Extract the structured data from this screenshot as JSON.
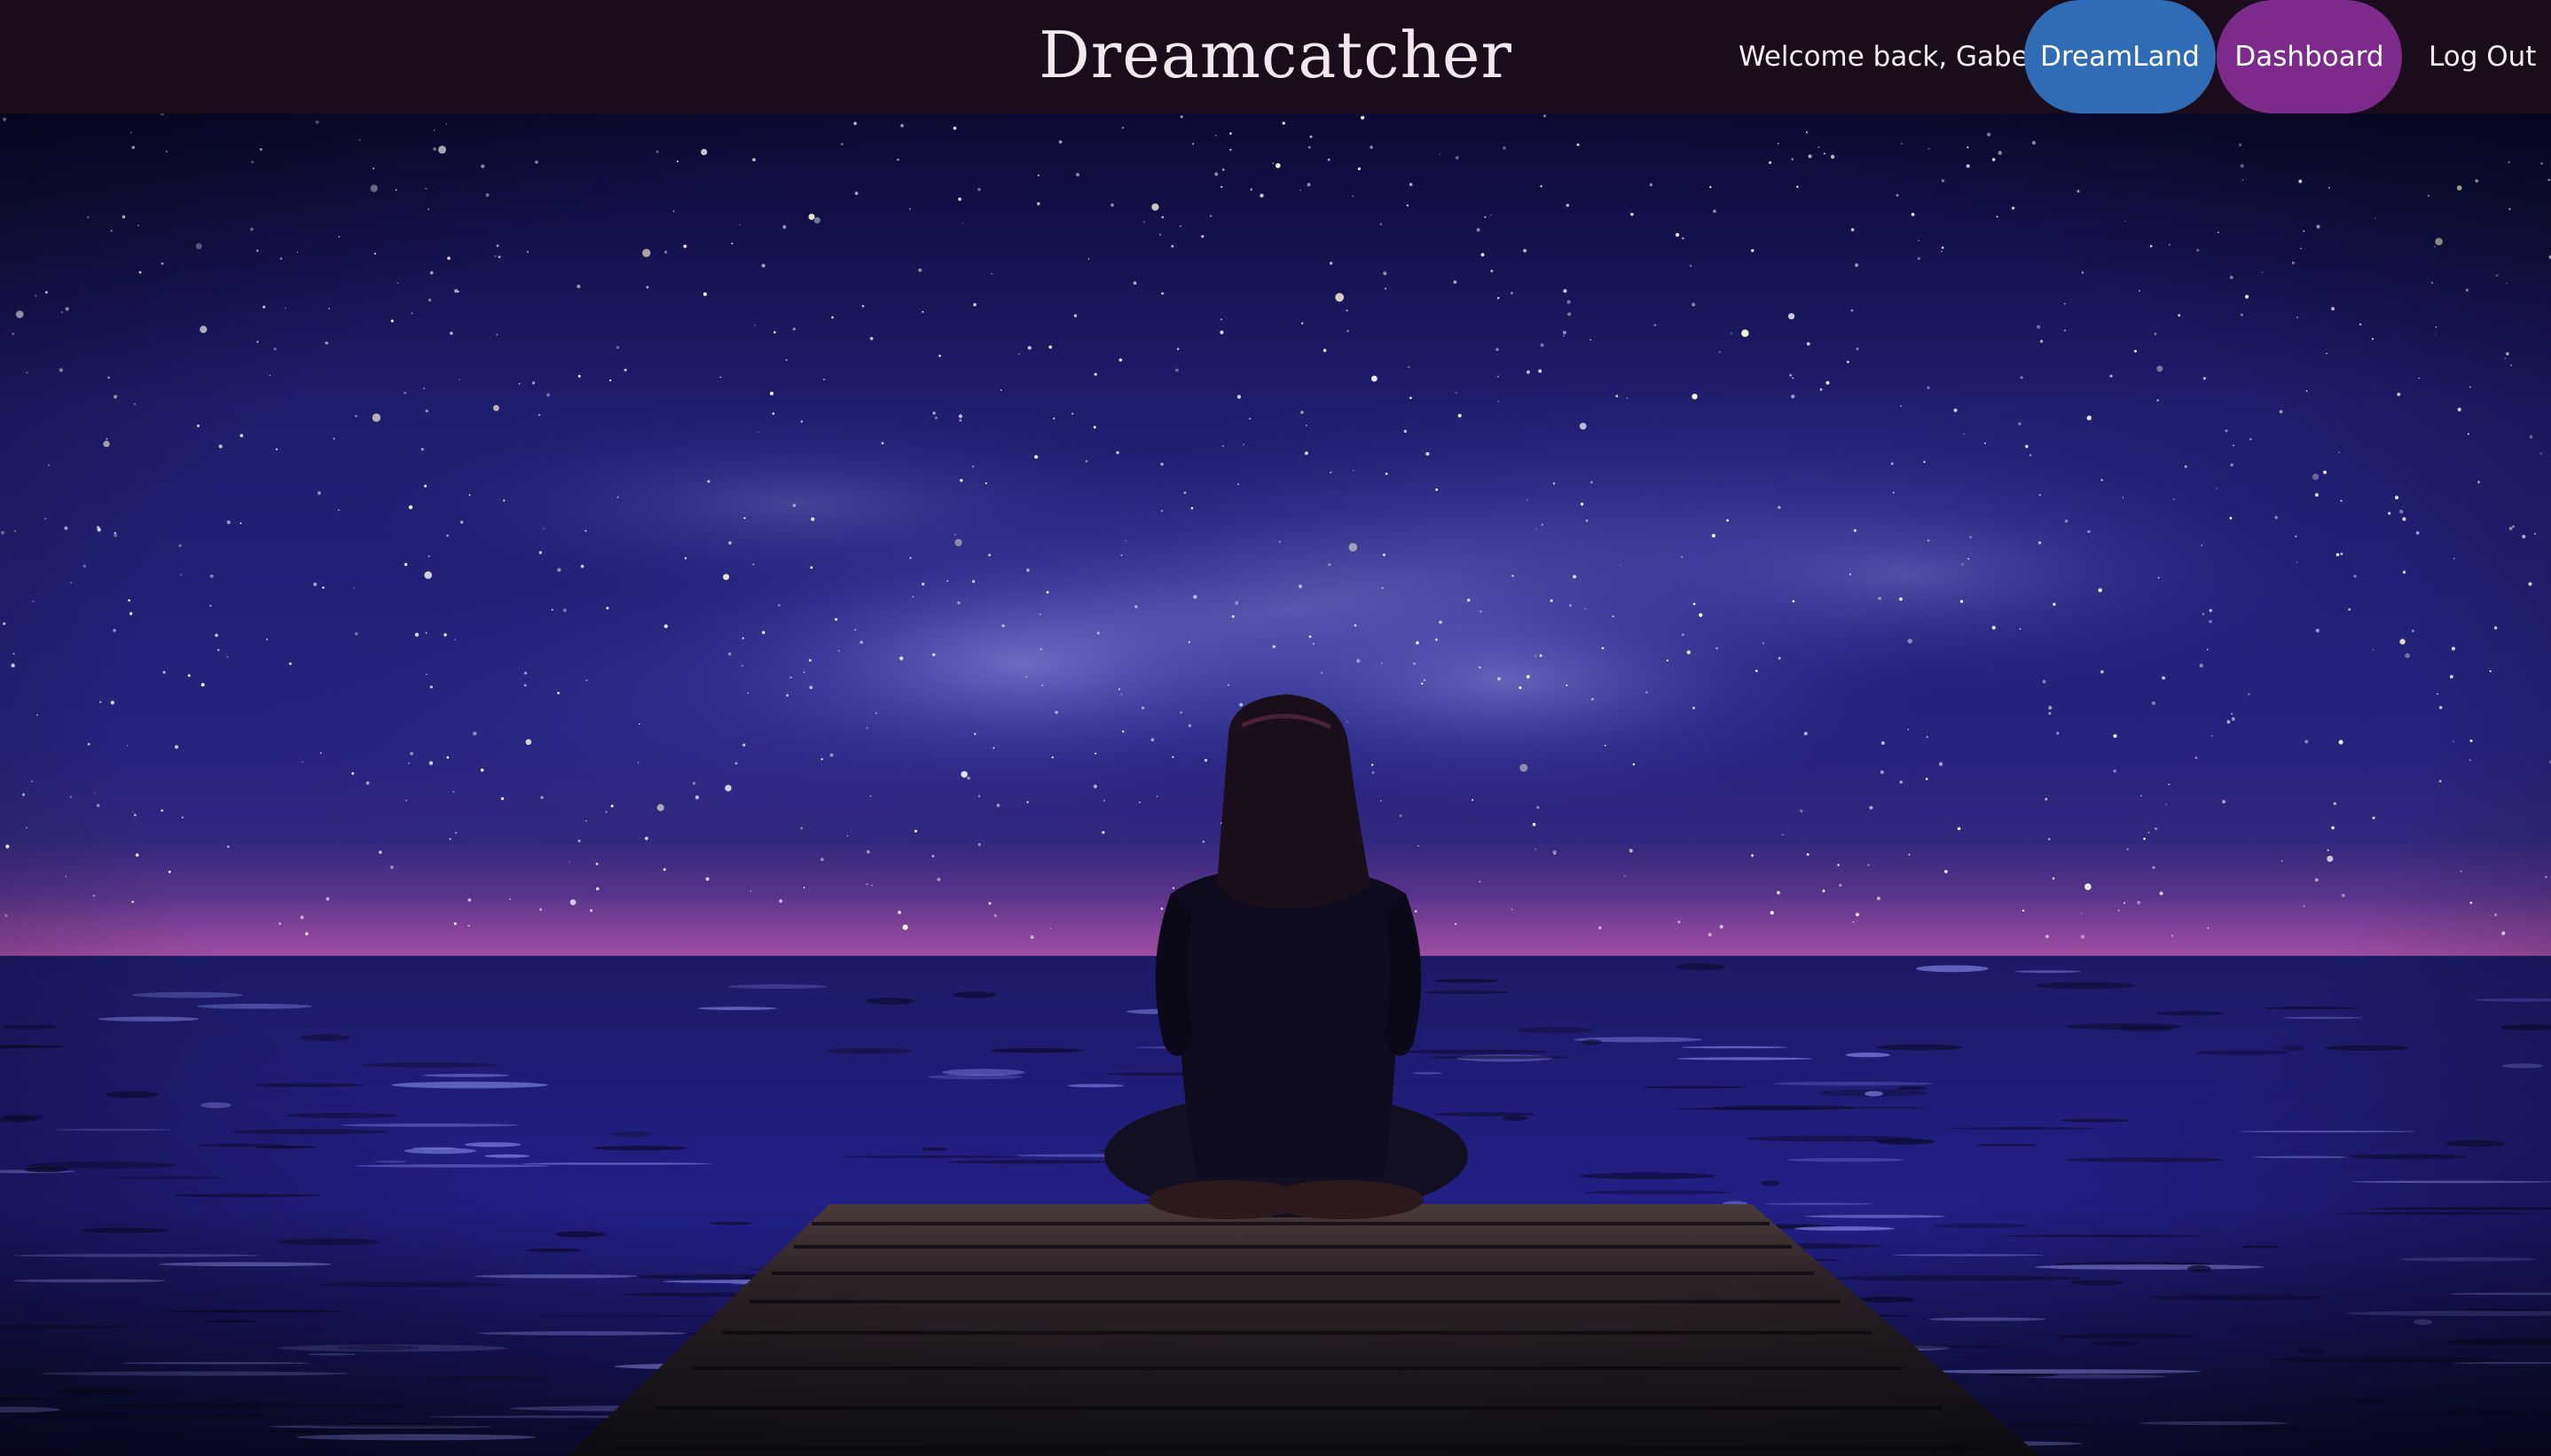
{
  "header": {
    "brand": "Dreamcatcher",
    "welcome": "Welcome back, Gabe",
    "nav": {
      "dreamland": "DreamLand",
      "dashboard": "Dashboard",
      "logout": "Log Out"
    }
  },
  "colors": {
    "navbar_bg": "#1b0c1c",
    "dreamland_button": "#2f6cb5",
    "dashboard_button": "#7d2a8c",
    "sky": "#2a2a8a",
    "horizon_glow": "#8a3c9a",
    "water": "#23208a"
  }
}
